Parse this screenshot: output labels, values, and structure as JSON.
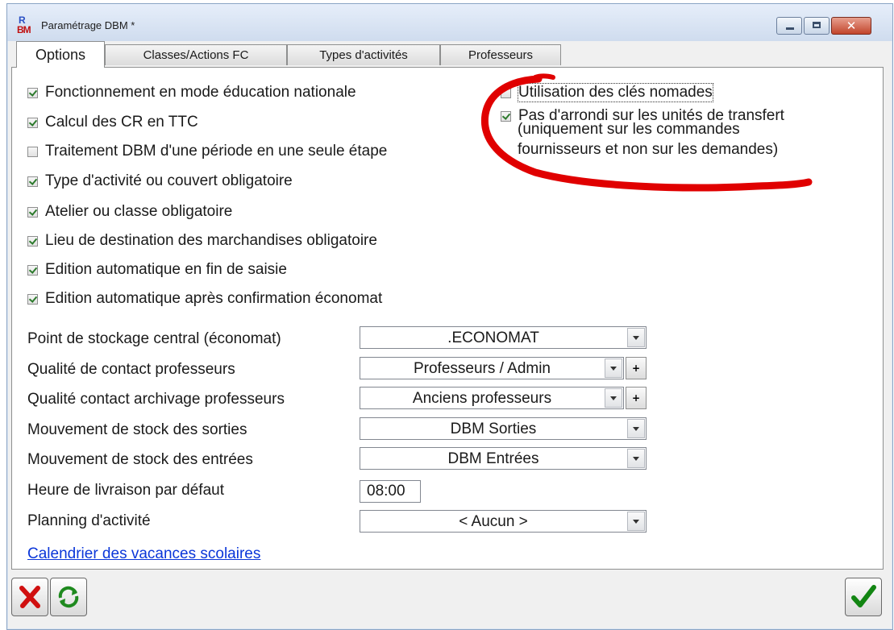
{
  "window": {
    "title": "Paramétrage DBM *",
    "icon": "dbm-app-icon",
    "icon_text_top": "R",
    "icon_text_bottom": "BM"
  },
  "tabs": [
    {
      "label": "Options",
      "active": true
    },
    {
      "label": "Classes/Actions FC",
      "active": false
    },
    {
      "label": "Types d'activités",
      "active": false
    },
    {
      "label": "Professeurs",
      "active": false
    }
  ],
  "checkboxes_left": [
    {
      "label": "Fonctionnement en mode éducation nationale",
      "checked": true
    },
    {
      "label": "Calcul des CR en TTC",
      "checked": true
    },
    {
      "label": "Traitement DBM d'une période en une seule étape",
      "checked": false
    },
    {
      "label": "Type d'activité ou couvert obligatoire",
      "checked": true
    },
    {
      "label": "Atelier ou classe obligatoire",
      "checked": true
    },
    {
      "label": "Lieu de destination des marchandises obligatoire",
      "checked": true
    },
    {
      "label": "Edition automatique en fin de saisie",
      "checked": true
    },
    {
      "label": "Edition automatique après confirmation économat",
      "checked": true
    }
  ],
  "checkboxes_right": [
    {
      "label": "Utilisation des clés nomades",
      "checked": false
    },
    {
      "label": "Pas d'arrondi sur les unités de transfert",
      "checked": true,
      "continuation": [
        "(uniquement sur les commandes",
        "fournisseurs et non sur les demandes)"
      ]
    }
  ],
  "fields": [
    {
      "label": "Point de stockage central (économat)",
      "value": ".ECONOMAT",
      "has_plus": false
    },
    {
      "label": "Qualité de contact professeurs",
      "value": "Professeurs / Admin",
      "has_plus": true
    },
    {
      "label": "Qualité contact archivage professeurs",
      "value": "Anciens professeurs",
      "has_plus": true
    },
    {
      "label": "Mouvement de stock des sorties",
      "value": "DBM Sorties",
      "has_plus": false
    },
    {
      "label": "Mouvement de stock des entrées",
      "value": "DBM Entrées",
      "has_plus": false
    },
    {
      "label": "Heure de livraison par défaut",
      "value": "08:00",
      "type": "time"
    },
    {
      "label": "Planning d'activité",
      "value": "< Aucun >",
      "has_plus": false
    }
  ],
  "plus_label": "+",
  "link": {
    "label": "Calendrier des vacances scolaires"
  },
  "buttons": {
    "cancel_icon": "red-x-icon",
    "refresh_icon": "green-refresh-icon",
    "ok_icon": "green-check-icon"
  },
  "colors": {
    "check": "#2c7a2c",
    "annotation": "#e00000",
    "link": "#0a36d9"
  }
}
